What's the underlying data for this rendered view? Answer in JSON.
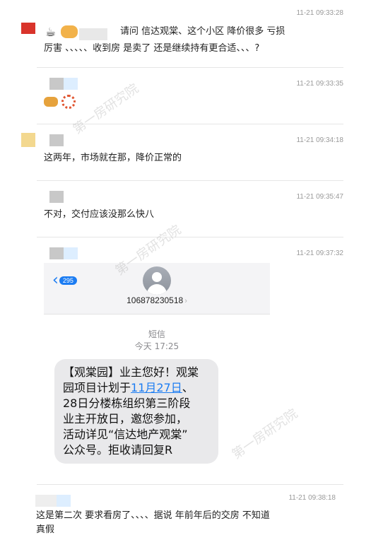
{
  "messages": [
    {
      "timestamp": "11-21 09:33:28",
      "text_line1": "请问     信达观棠、这个小区     降价很多     亏损",
      "text_line2": "厉害  、、、、、收到房  是卖了   还是继续持有更合适、、、?"
    },
    {
      "timestamp": "11-21 09:33:35"
    },
    {
      "timestamp": "11-21 09:34:18",
      "text": "这两年，市场就在那，降价正常的"
    },
    {
      "timestamp": "11-21 09:35:47",
      "text": "不对，交付应该没那么快八"
    },
    {
      "timestamp": "11-21 09:37:32"
    },
    {
      "timestamp": "11-21 09:38:18",
      "text_line1": "这是第二次  要求看房了、、、、据说  年前年后的交房  不知道",
      "text_line2": "真假"
    }
  ],
  "sms": {
    "back_badge": "295",
    "number": "106878230518",
    "kind": "短信",
    "time": "今天 17:25",
    "line1": "【观棠园】业主您好！观棠",
    "line2_prefix": "园项目计划于",
    "line2_link": "11月27日",
    "line2_suffix": "、",
    "line3": "28日分楼栋组织第三阶段",
    "line4": "业主开放日，邀您参加，",
    "line5": "活动详见“信达地产观棠”",
    "line6": "公众号。拒收请回复R"
  },
  "watermark": "第一房研究院",
  "icons": [
    "coffee-icon",
    "handshake-icon",
    "bread-icon",
    "firework-icon"
  ]
}
